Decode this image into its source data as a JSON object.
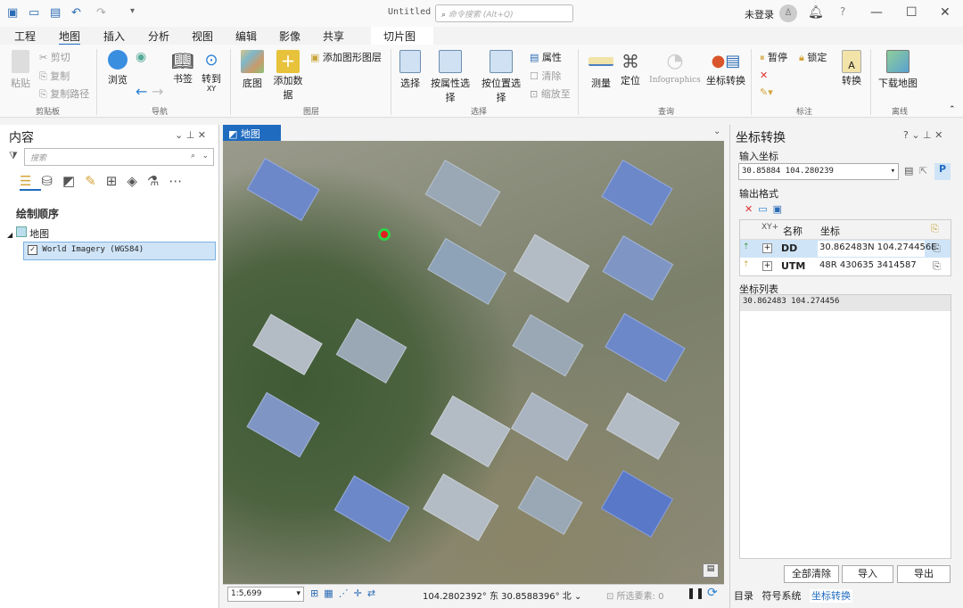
{
  "title_bar": {
    "doc_title": "Untitled",
    "search_placeholder": "命令搜索 (Alt+Q)",
    "user": "未登录",
    "help": "?"
  },
  "tabs": [
    "工程",
    "地图",
    "插入",
    "分析",
    "视图",
    "编辑",
    "影像",
    "共享"
  ],
  "contextual_tab": "切片图层",
  "ribbon": {
    "clipboard": {
      "paste": "粘贴",
      "cut": "剪切",
      "copy": "复制",
      "copy_path": "复制路径",
      "group": "剪贴板"
    },
    "navigate": {
      "explore": "浏览",
      "bookmarks": "书签",
      "goto_xy": "转到",
      "goto_xy_sub": "XY",
      "group": "导航"
    },
    "layer": {
      "basemap": "底图",
      "add_data": "添加数据",
      "add_graphics": "添加图形图层",
      "group": "图层"
    },
    "selection": {
      "select": "选择",
      "by_attr": "按属性选择",
      "by_loc": "按位置选择",
      "attributes": "属性",
      "clear": "清除",
      "zoom_to": "缩放至",
      "group": "选择"
    },
    "inquiry": {
      "measure": "测量",
      "locate": "定位",
      "infographics": "Infographics",
      "coord_conv": "坐标转换",
      "group": "查询"
    },
    "labeling": {
      "pause": "暂停",
      "lock": "锁定",
      "convert": "转换",
      "group": "标注"
    },
    "offline": {
      "download": "下载地图",
      "group": "离线"
    }
  },
  "contents": {
    "title": "内容",
    "search_placeholder": "搜索",
    "drawing_order": "绘制顺序",
    "map": "地图",
    "layer": "World Imagery (WGS84)"
  },
  "map_view": {
    "tab": "地图",
    "scale": "1:5,699",
    "coords": "104.2802392° 东 30.8588396° 北",
    "selected": "所选要素: 0"
  },
  "coord_panel": {
    "title": "坐标转换",
    "input_label": "输入坐标",
    "input_value": "30.85884 104.280239",
    "output_label": "输出格式",
    "headers": [
      "名称",
      "坐标"
    ],
    "rows": [
      {
        "name": "DD",
        "value": "30.862483N 104.274456E"
      },
      {
        "name": "UTM",
        "value": "48R 430635 3414587"
      }
    ],
    "list_label": "坐标列表",
    "list_items": [
      "30.862483 104.274456"
    ],
    "clear_all": "全部清除",
    "import": "导入",
    "export": "导出"
  },
  "bottom_tabs": [
    "目录",
    "符号系统",
    "坐标转换"
  ],
  "colors": {
    "accent": "#1f6bbf",
    "selected_row": "#cfe4f7",
    "marker": "#e02020"
  }
}
